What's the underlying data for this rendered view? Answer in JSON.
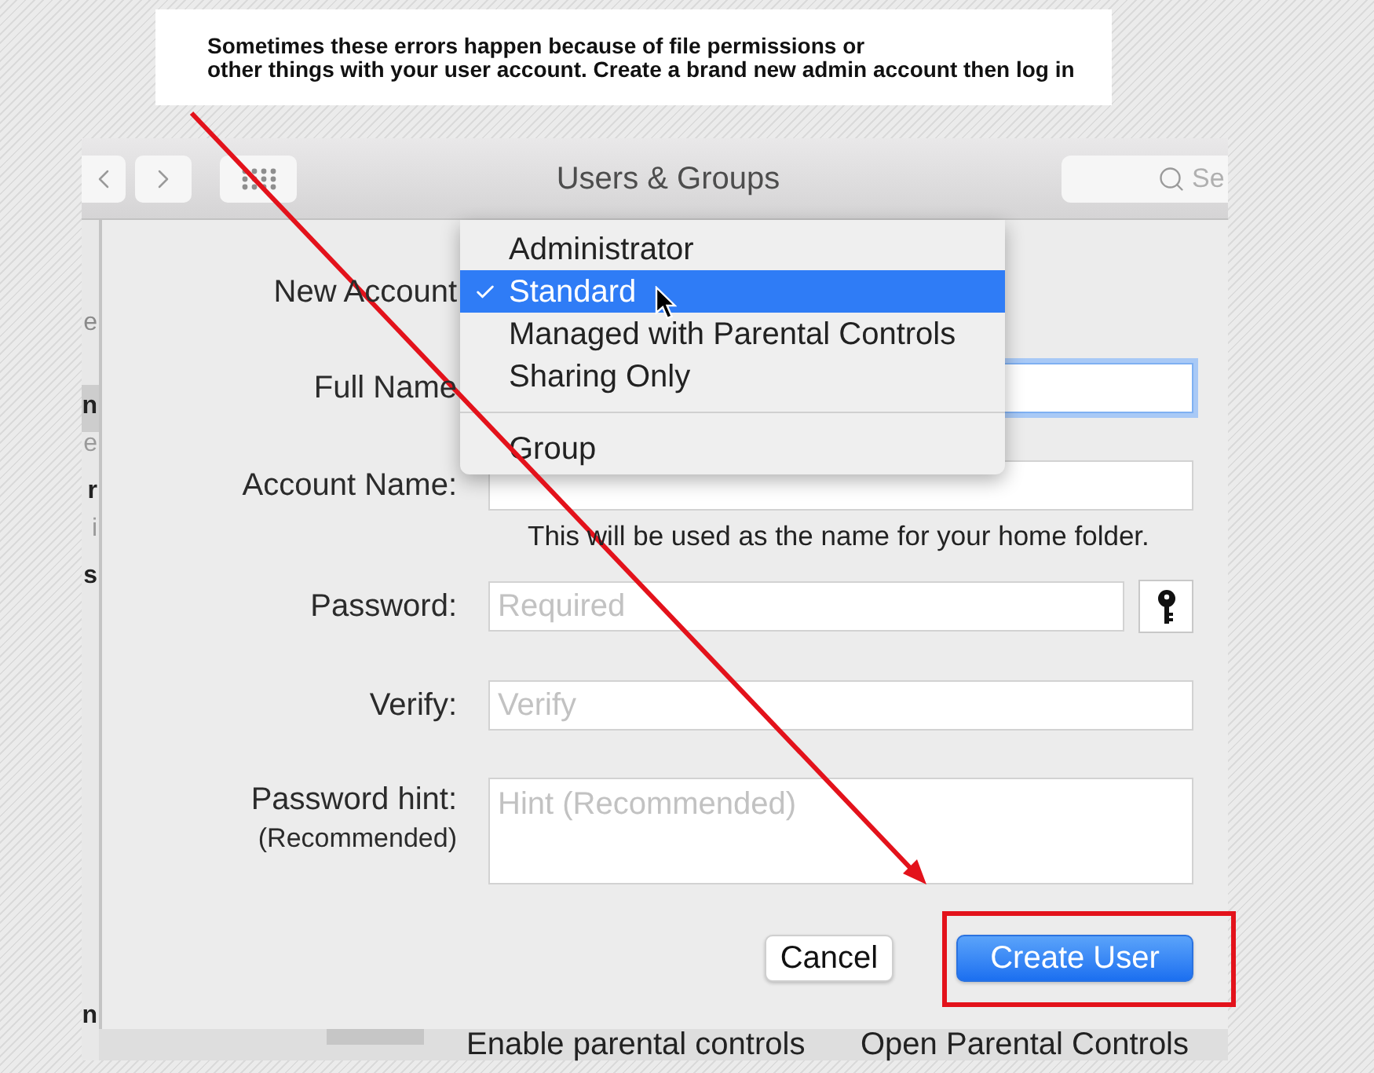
{
  "annotation": {
    "text": "Sometimes these errors happen because of file permissions or\nother things with your user account. Create a brand new admin account then log in"
  },
  "window": {
    "title": "Users & Groups",
    "search": {
      "placeholder": "Se"
    }
  },
  "sidebar": {
    "items": [
      {
        "kind": "heading",
        "text": "e",
        "selected": false
      },
      {
        "kind": "name",
        "text": "n",
        "selected": true
      },
      {
        "kind": "detail",
        "text": "e",
        "selected": false
      },
      {
        "kind": "name",
        "text": "r",
        "selected": false
      },
      {
        "kind": "detail",
        "text": "i",
        "selected": false
      },
      {
        "kind": "name",
        "text": "s",
        "selected": false
      }
    ],
    "footer": "n"
  },
  "dialog": {
    "account_type": {
      "label": "New Account"
    },
    "fields": [
      {
        "kind": "text",
        "label": "Full Name",
        "focused": true
      },
      {
        "kind": "text",
        "label": "Account Name:",
        "focused": false,
        "note": "This will be used as the name for your home folder."
      },
      {
        "kind": "password",
        "label": "Password:",
        "placeholder": "Required",
        "focused": false
      },
      {
        "kind": "text",
        "label": "Verify:",
        "placeholder": "Verify",
        "focused": false
      },
      {
        "kind": "textarea",
        "label": "Password hint:",
        "sublabel": "(Recommended)",
        "placeholder": "Hint (Recommended)",
        "focused": false
      }
    ],
    "buttons": [
      {
        "kind": "secondary",
        "label": "Cancel",
        "highlighted": false
      },
      {
        "kind": "primary",
        "label": "Create User",
        "highlighted": true
      }
    ]
  },
  "menu": {
    "items": [
      {
        "label": "Administrator",
        "selected": false,
        "checked": false,
        "separator_before": false
      },
      {
        "label": "Standard",
        "selected": true,
        "checked": true,
        "separator_before": false
      },
      {
        "label": "Managed with Parental Controls",
        "selected": false,
        "checked": false,
        "separator_before": false
      },
      {
        "label": "Sharing Only",
        "selected": false,
        "checked": false,
        "separator_before": false
      },
      {
        "label": "Group",
        "selected": false,
        "checked": false,
        "separator_before": true
      }
    ]
  },
  "bottom_bar": {
    "items": [
      "Enable parental controls",
      "Open Parental Controls"
    ]
  }
}
